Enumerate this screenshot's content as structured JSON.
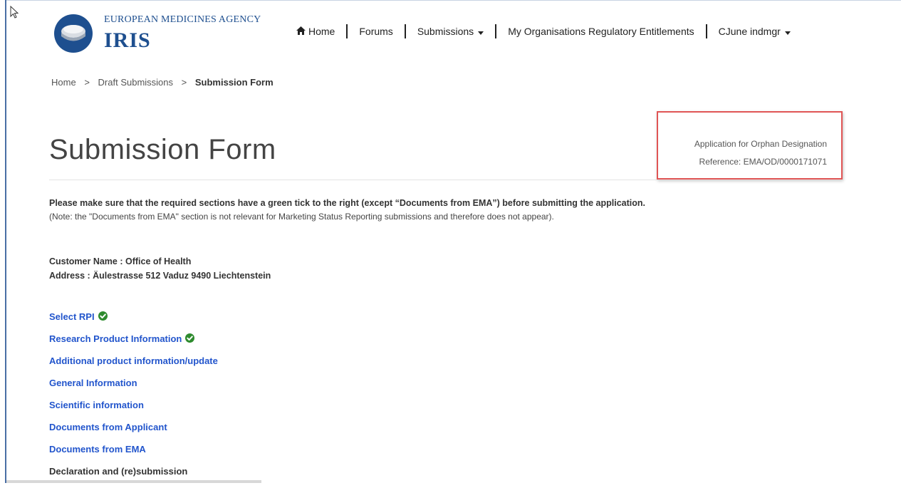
{
  "header": {
    "agency": "EUROPEAN MEDICINES AGENCY",
    "app_name": "IRIS"
  },
  "nav": {
    "home": "Home",
    "forums": "Forums",
    "submissions": "Submissions",
    "entitlements": "My Organisations Regulatory Entitlements",
    "user": "CJune indmgr"
  },
  "breadcrumb": {
    "items": [
      "Home",
      "Draft Submissions"
    ],
    "current": "Submission Form",
    "separator": ">"
  },
  "page": {
    "title": "Submission Form",
    "application_type": "Application for Orphan Designation",
    "reference": "Reference: EMA/OD/0000171071",
    "instruction": "Please make sure that the required sections have a green tick to the right (except “Documents from EMA”) before submitting the application.",
    "note": "(Note: the \"Documents from EMA\" section is not relevant for Marketing Status Reporting submissions and therefore does not appear).",
    "customer_name": "Customer Name : Office of Health",
    "address": "Address : Äulestrasse 512 Vaduz 9490 Liechtenstein"
  },
  "sections": [
    {
      "label": "Select RPI",
      "complete": true
    },
    {
      "label": "Research Product Information",
      "complete": true
    },
    {
      "label": "Additional product information/update",
      "complete": false
    },
    {
      "label": "General Information",
      "complete": false
    },
    {
      "label": "Scientific information",
      "complete": false
    },
    {
      "label": "Documents from Applicant",
      "complete": false
    },
    {
      "label": "Documents from EMA",
      "complete": false
    },
    {
      "label": "Declaration and (re)submission",
      "complete": false
    }
  ],
  "colors": {
    "brand": "#1e4f8f",
    "link": "#2255cc",
    "tick": "#2e8b2e",
    "highlight": "#e05555"
  },
  "icons": {
    "home": "home-icon",
    "caret": "caret-down-icon",
    "tick": "check-circle-icon",
    "cursor": "mouse-pointer-icon"
  }
}
